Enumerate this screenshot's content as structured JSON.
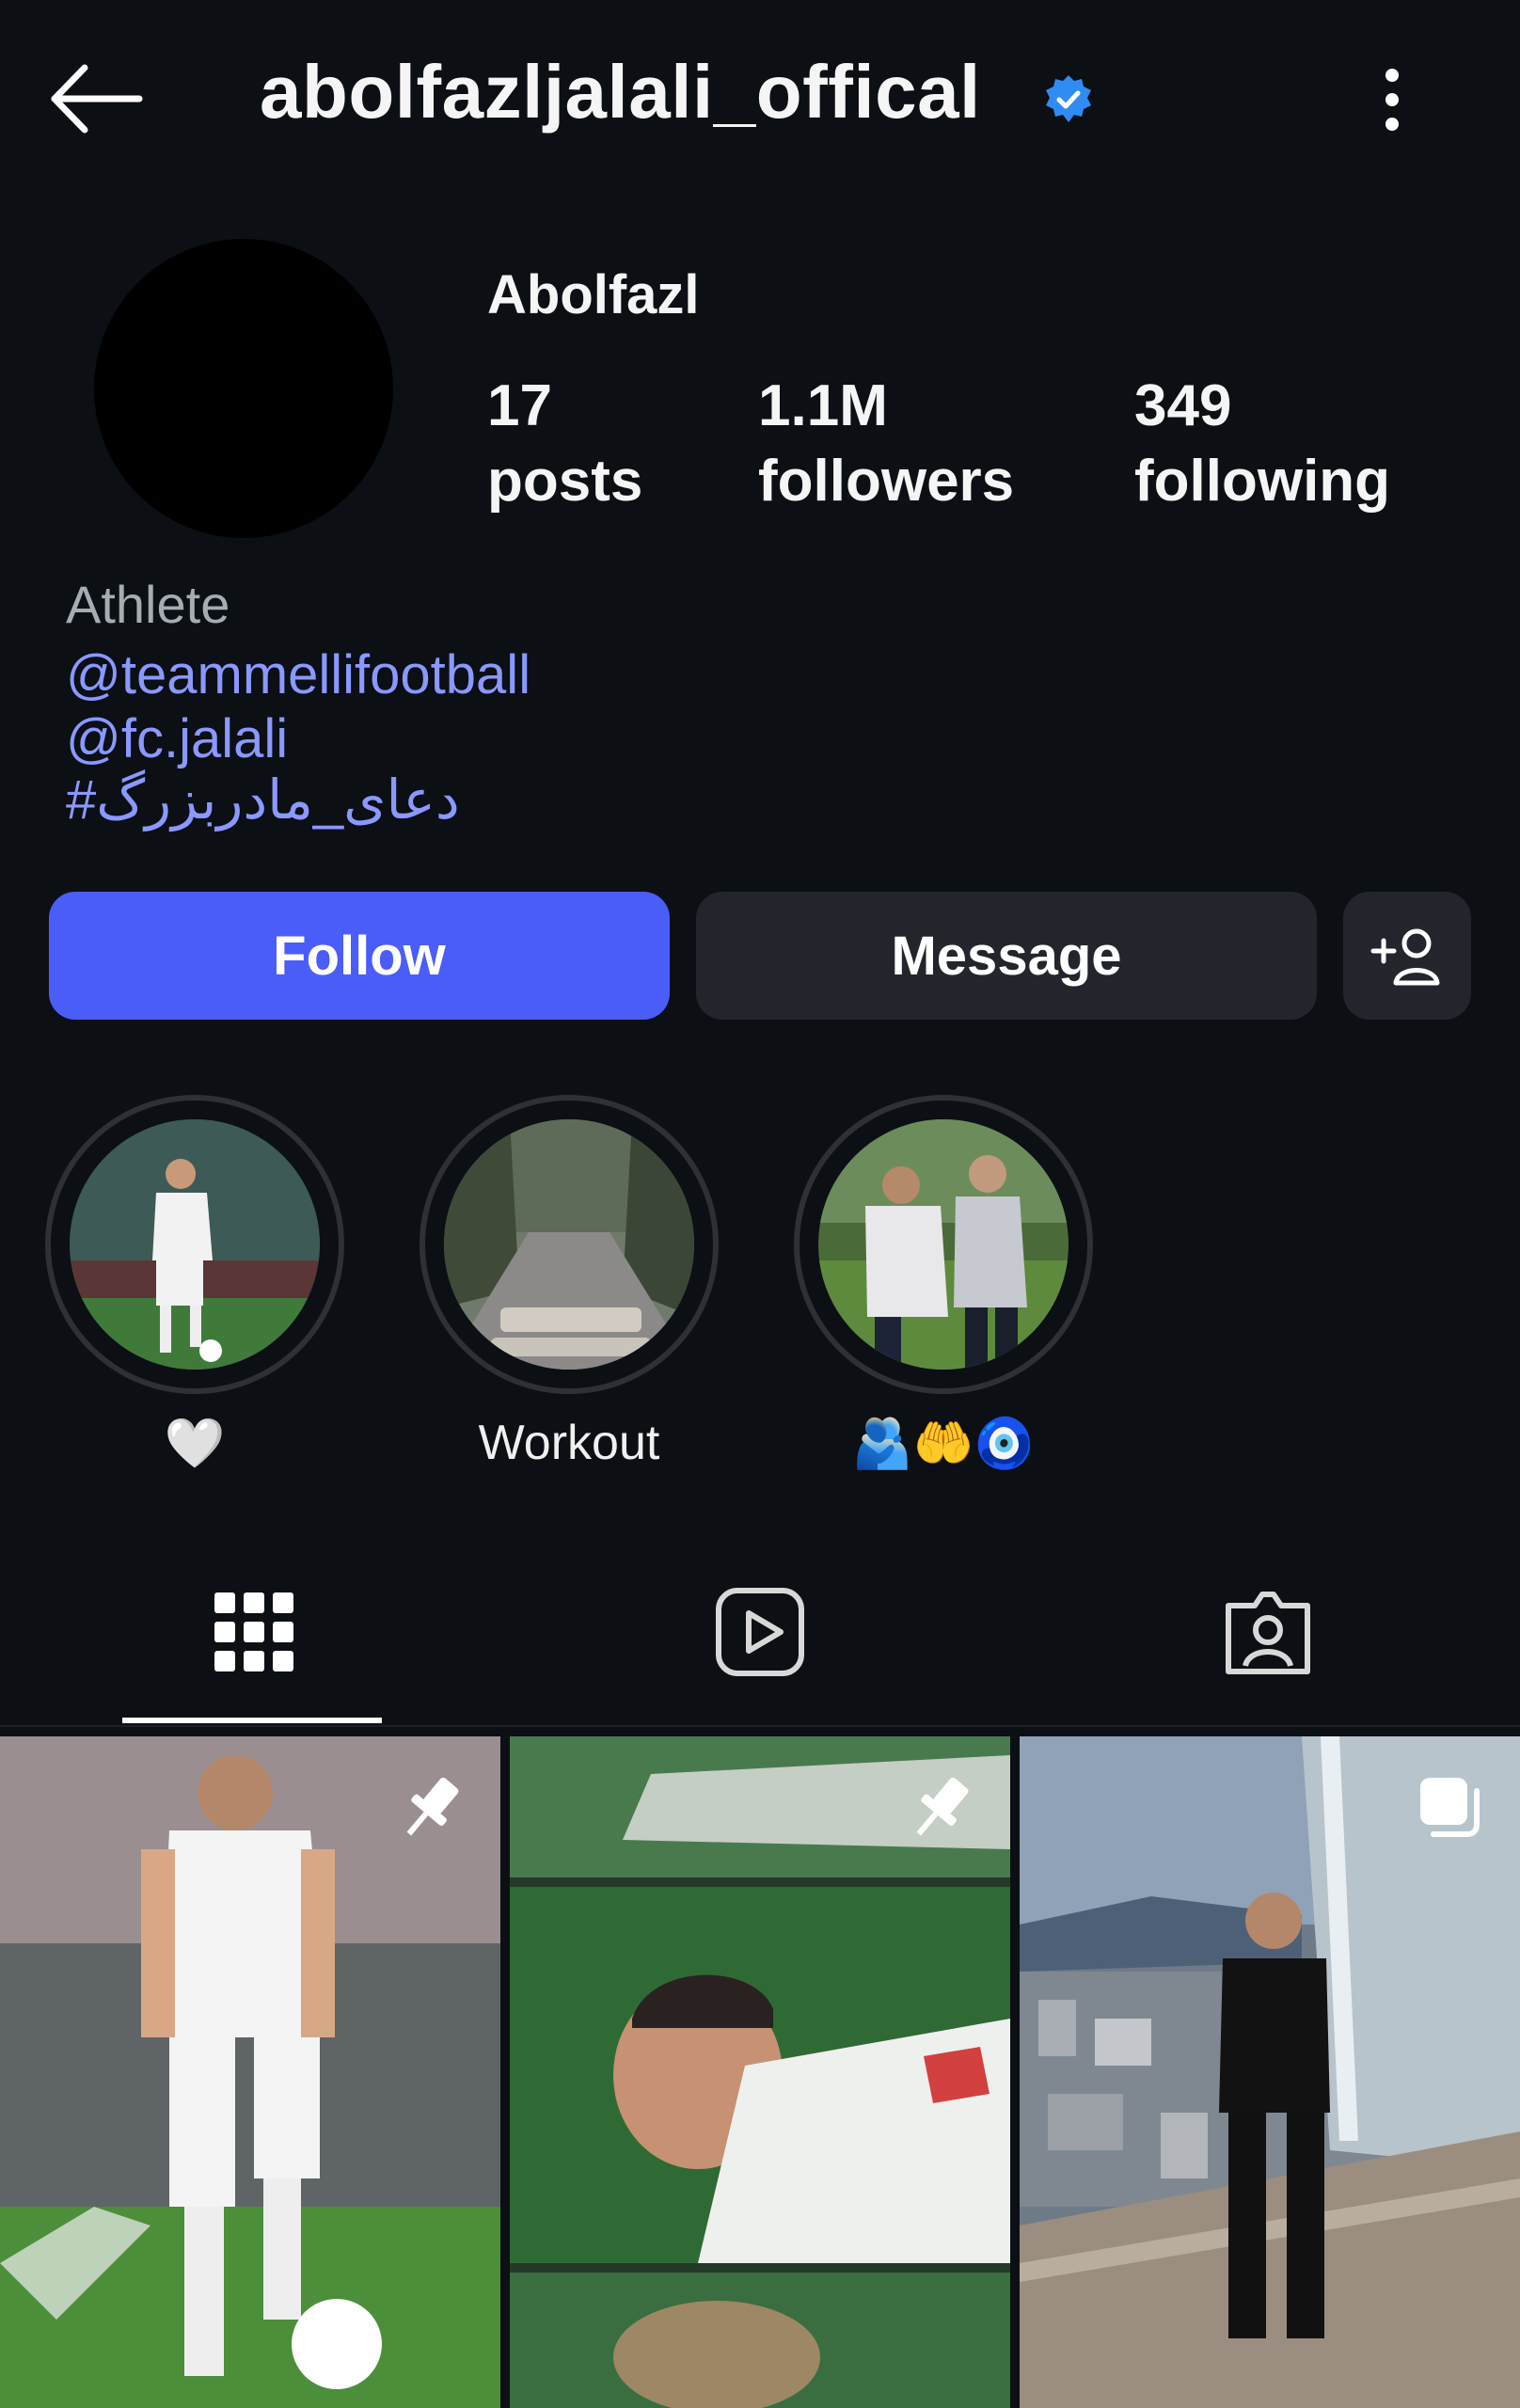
{
  "header": {
    "username": "abolfazljalali_offical"
  },
  "profile": {
    "display_name": "Abolfazl",
    "stats": [
      {
        "value": "17",
        "label": "posts"
      },
      {
        "value": "1.1M",
        "label": "followers"
      },
      {
        "value": "349",
        "label": "following"
      }
    ],
    "category": "Athlete",
    "bio_lines": [
      "@teammellifootball",
      "@fc.jalali",
      "#دعای_مادربزرگ"
    ]
  },
  "actions": {
    "follow_label": "Follow",
    "message_label": "Message"
  },
  "highlights": [
    {
      "label": "🤍",
      "icon": "heart"
    },
    {
      "label": "Workout"
    },
    {
      "label": "🫂🤲🧿"
    }
  ],
  "tabs": [
    {
      "icon": "grid-icon",
      "selected": true
    },
    {
      "icon": "reels-icon",
      "selected": false
    },
    {
      "icon": "tagged-icon",
      "selected": false
    }
  ],
  "posts": [
    {
      "badge": "pin-icon"
    },
    {
      "badge": "pin-icon"
    },
    {
      "badge": "carousel-icon"
    }
  ],
  "colors": {
    "background": "#0c0f14",
    "follow_button": "#4a5df9",
    "secondary_button": "#22262c",
    "link": "#8a98ff",
    "verified": "#2f8cf2"
  }
}
